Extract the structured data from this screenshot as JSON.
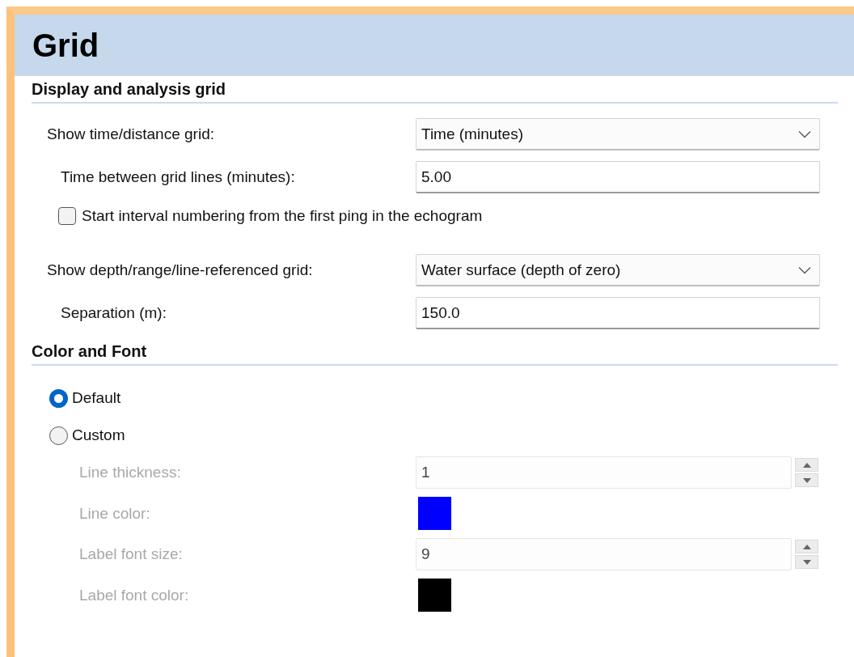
{
  "window": {
    "title": "Grid"
  },
  "sections": [
    {
      "title": "Display and analysis grid",
      "rows": [
        {
          "kind": "dropdown",
          "label": "Show time/distance grid:",
          "value": "Time (minutes)",
          "children": [
            {
              "kind": "text",
              "label": "Time between grid lines (minutes):",
              "value": "5.00"
            },
            {
              "kind": "checkbox",
              "label": "Start interval numbering from the first ping in the echogram",
              "checked": false
            }
          ]
        },
        {
          "kind": "dropdown",
          "label": "Show depth/range/line-referenced grid:",
          "value": "Water surface (depth of zero)",
          "children": [
            {
              "kind": "text",
              "label": "Separation (m):",
              "value": "150.0"
            }
          ]
        }
      ]
    },
    {
      "title": "Color and Font",
      "rows": [
        {
          "kind": "radio",
          "label": "Default",
          "selected": true
        },
        {
          "kind": "radio",
          "label": "Custom",
          "selected": false,
          "children": [
            {
              "kind": "spin",
              "label": "Line thickness:",
              "value": "1",
              "disabled": true
            },
            {
              "kind": "color",
              "label": "Line color:",
              "color": "#0000ff",
              "disabled": true
            },
            {
              "kind": "spin",
              "label": "Label font size:",
              "value": "9",
              "disabled": true
            },
            {
              "kind": "color",
              "label": "Label font color:",
              "color": "#000000",
              "disabled": true
            }
          ]
        }
      ]
    }
  ]
}
